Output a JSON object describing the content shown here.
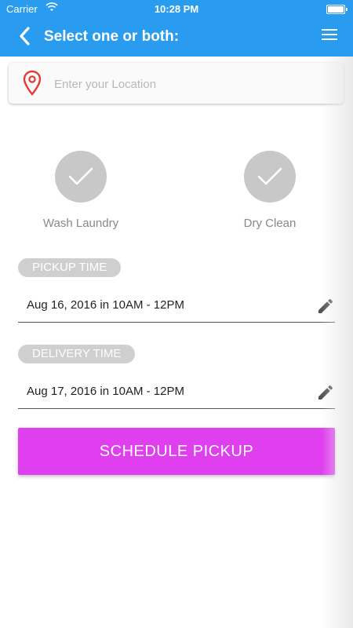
{
  "status_bar": {
    "carrier": "Carrier",
    "time": "10:28 PM"
  },
  "header": {
    "title": "Select one or both:",
    "back_icon": "chevron-left-icon",
    "menu_icon": "hamburger-menu-icon"
  },
  "location": {
    "placeholder": "Enter your Location",
    "value": "",
    "icon": "map-pin-icon"
  },
  "services": [
    {
      "label": "Wash Laundry"
    },
    {
      "label": "Dry Clean"
    }
  ],
  "pickup": {
    "label": "PICKUP TIME",
    "value": "Aug 16, 2016 in 10AM - 12PM"
  },
  "delivery": {
    "label": "DELIVERY TIME",
    "value": "Aug 17, 2016 in 10AM - 12PM"
  },
  "cta": {
    "label": "SCHEDULE PICKUP"
  },
  "colors": {
    "header": "#2a9cf0",
    "cta": "#e03ff0",
    "pin": "#e53935",
    "pill": "#cfcfcf"
  }
}
